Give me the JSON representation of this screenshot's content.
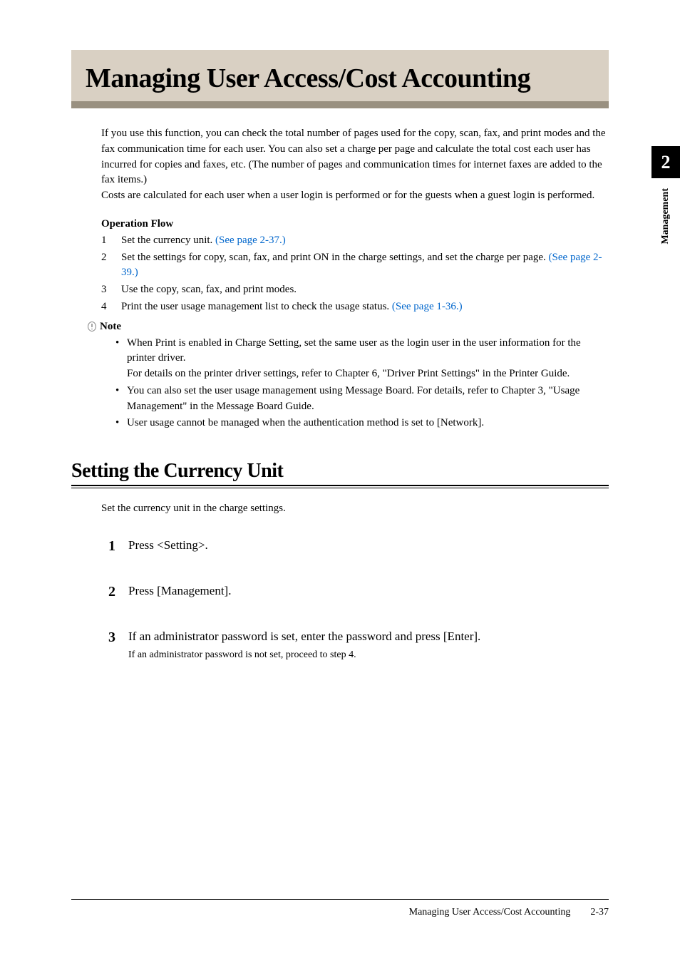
{
  "sideTab": {
    "number": "2",
    "label": "Management"
  },
  "mainHeading": "Managing User Access/Cost Accounting",
  "introPara1": "If you use this function, you can check the total number of pages used for the copy, scan, fax, and print modes and the fax communication time for each user. You can also set a charge per page and calculate the total cost each user has incurred for copies and faxes, etc. (The number of pages and communication times for internet faxes are added to the fax items.)",
  "introPara2": "Costs are calculated for each user when a user login is performed or for the guests when a guest login is performed.",
  "operationFlowLabel": "Operation Flow",
  "flowItems": [
    {
      "num": "1",
      "text": "Set the currency unit. ",
      "link": "(See page 2-37.)"
    },
    {
      "num": "2",
      "text": "Set the settings for copy, scan, fax, and print ON in the charge settings, and set the charge per page. ",
      "link": "(See page 2-39.)"
    },
    {
      "num": "3",
      "text": "Use the copy, scan, fax, and print modes.",
      "link": ""
    },
    {
      "num": "4",
      "text": "Print the user usage management list to check the usage status. ",
      "link": "(See page 1-36.)"
    }
  ],
  "noteLabel": "Note",
  "noteBullets": [
    "When Print is enabled in Charge Setting, set the same user as the login user in the user information for the printer driver.\nFor details on the printer driver settings, refer to Chapter 6, \"Driver Print Settings\" in the Printer Guide.",
    "You can also set the user usage management using Message Board. For details, refer to Chapter 3, \"Usage Management\" in the Message Board Guide.",
    "User usage cannot be managed when the authentication method is set to [Network]."
  ],
  "sectionHeading": "Setting the Currency Unit",
  "sectionIntro": "Set the currency unit in the charge settings.",
  "steps": [
    {
      "num": "1",
      "main": "Press <Setting>.",
      "sub": ""
    },
    {
      "num": "2",
      "main": "Press [Management].",
      "sub": ""
    },
    {
      "num": "3",
      "main": "If an administrator password is set, enter the password and press [Enter].",
      "sub": "If an administrator password is not set, proceed to step 4."
    }
  ],
  "footer": {
    "title": "Managing User Access/Cost Accounting",
    "pageNum": "2-37"
  }
}
